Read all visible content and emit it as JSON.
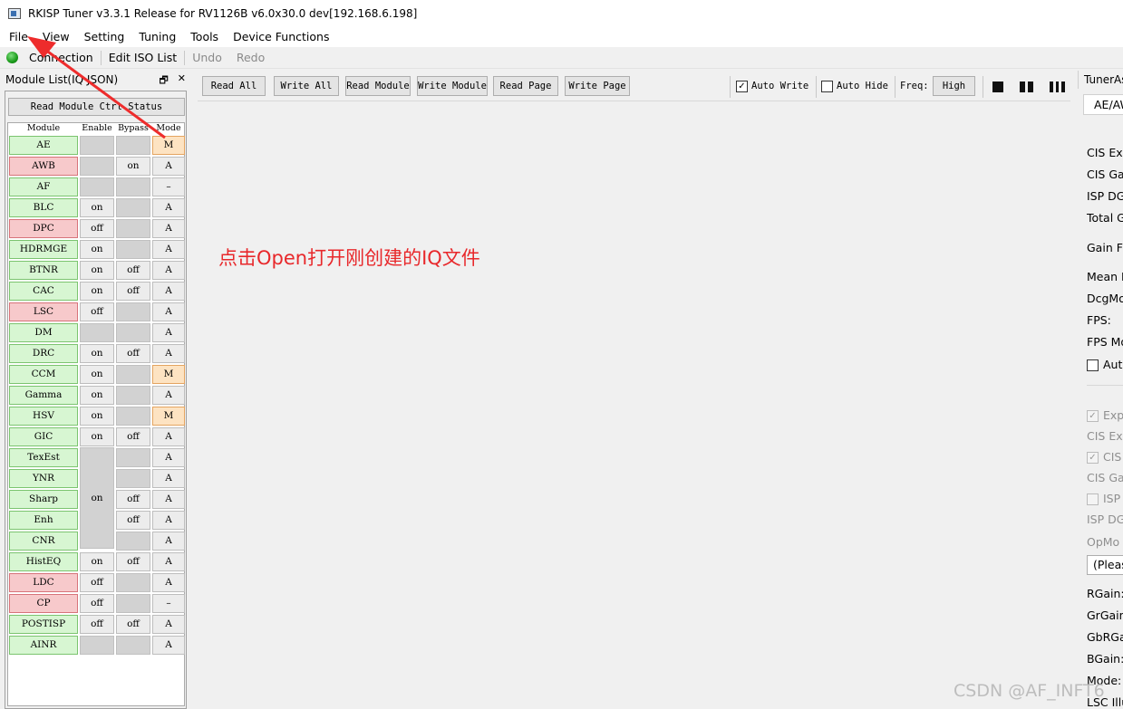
{
  "window": {
    "title": "RKISP Tuner v3.3.1 Release for RV1126B v6.0x30.0 dev[192.168.6.198]"
  },
  "menu": {
    "items": [
      "File",
      "View",
      "Setting",
      "Tuning",
      "Tools",
      "Device Functions"
    ]
  },
  "toolbar": {
    "connection": "Connection",
    "edit_iso": "Edit ISO List",
    "undo": "Undo",
    "redo": "Redo",
    "status_color": "#1a9a1a"
  },
  "left_dock": {
    "title": "Module List(IQ JSON)",
    "read_button": "Read Module Ctrl Status",
    "headers": {
      "module": "Module",
      "enable": "Enable",
      "bypass": "Bypass",
      "mode": "Mode"
    },
    "modules": [
      {
        "name": "AE",
        "enable": "",
        "bypass": "",
        "mode": "M",
        "status": "green"
      },
      {
        "name": "AWB",
        "enable": "",
        "bypass": "on",
        "mode": "A",
        "status": "red"
      },
      {
        "name": "AF",
        "enable": "",
        "bypass": "",
        "mode": "–",
        "status": "green"
      },
      {
        "name": "BLC",
        "enable": "on",
        "bypass": "",
        "mode": "A",
        "status": "green"
      },
      {
        "name": "DPC",
        "enable": "off",
        "bypass": "",
        "mode": "A",
        "status": "red"
      },
      {
        "name": "HDRMGE",
        "enable": "on",
        "bypass": "",
        "mode": "A",
        "status": "green"
      },
      {
        "name": "BTNR",
        "enable": "on",
        "bypass": "off",
        "mode": "A",
        "status": "green"
      },
      {
        "name": "CAC",
        "enable": "on",
        "bypass": "off",
        "mode": "A",
        "status": "green"
      },
      {
        "name": "LSC",
        "enable": "off",
        "bypass": "",
        "mode": "A",
        "status": "red"
      },
      {
        "name": "DM",
        "enable": "",
        "bypass": "",
        "mode": "A",
        "status": "green"
      },
      {
        "name": "DRC",
        "enable": "on",
        "bypass": "off",
        "mode": "A",
        "status": "green"
      },
      {
        "name": "CCM",
        "enable": "on",
        "bypass": "",
        "mode": "M",
        "status": "green"
      },
      {
        "name": "Gamma",
        "enable": "on",
        "bypass": "",
        "mode": "A",
        "status": "green"
      },
      {
        "name": "HSV",
        "enable": "on",
        "bypass": "",
        "mode": "M",
        "status": "green"
      },
      {
        "name": "GIC",
        "enable": "on",
        "bypass": "off",
        "mode": "A",
        "status": "green"
      },
      {
        "name": "TexEst",
        "enable": "",
        "bypass": "",
        "mode": "A",
        "status": "green"
      },
      {
        "name": "YNR",
        "enable": "",
        "bypass": "",
        "mode": "A",
        "status": "green"
      },
      {
        "name": "Sharp",
        "enable": "",
        "bypass": "off",
        "mode": "A",
        "status": "green"
      },
      {
        "name": "Enh",
        "enable": "",
        "bypass": "off",
        "mode": "A",
        "status": "green"
      },
      {
        "name": "CNR",
        "enable": "",
        "bypass": "",
        "mode": "A",
        "status": "green"
      },
      {
        "name": "HistEQ",
        "enable": "on",
        "bypass": "off",
        "mode": "A",
        "status": "green"
      },
      {
        "name": "LDC",
        "enable": "off",
        "bypass": "",
        "mode": "A",
        "status": "red"
      },
      {
        "name": "CP",
        "enable": "off",
        "bypass": "",
        "mode": "–",
        "status": "red"
      },
      {
        "name": "POSTISP",
        "enable": "off",
        "bypass": "off",
        "mode": "A",
        "status": "green"
      },
      {
        "name": "AINR",
        "enable": "",
        "bypass": "",
        "mode": "A",
        "status": "green"
      }
    ],
    "merged_enable": "on"
  },
  "page_toolbar": {
    "buttons": [
      "Read All",
      "Write All",
      "Read Module",
      "Write Module",
      "Read Page",
      "Write Page"
    ],
    "auto_write": "Auto Write",
    "auto_write_checked": true,
    "auto_hide": "Auto Hide",
    "auto_hide_checked": false,
    "freq_label": "Freq:",
    "freq_value": "High"
  },
  "annotation": {
    "text": "点击Open打开刚创建的IQ文件",
    "color": "#e8282b"
  },
  "right_dock": {
    "title": "TunerAssistant",
    "tab": "AE/AWB",
    "labels": [
      "CIS Exp",
      "CIS Ga",
      "ISP DG",
      "Total G",
      "Gain Fo",
      "Mean I",
      "DcgMo",
      "FPS:",
      "FPS Mo"
    ],
    "auto_label": "Auto",
    "disabled_labels": [
      "Exp",
      "CIS Exp",
      "CIS",
      "CIS Ga",
      "ISP",
      "ISP DG",
      "OpMo"
    ],
    "select": "(Pleas",
    "gain_labels": [
      "RGain:",
      "GrGain",
      "GbRGa",
      "BGain:",
      "Mode:",
      "LSC Illu"
    ]
  },
  "watermark": "CSDN @AF_INFT6"
}
